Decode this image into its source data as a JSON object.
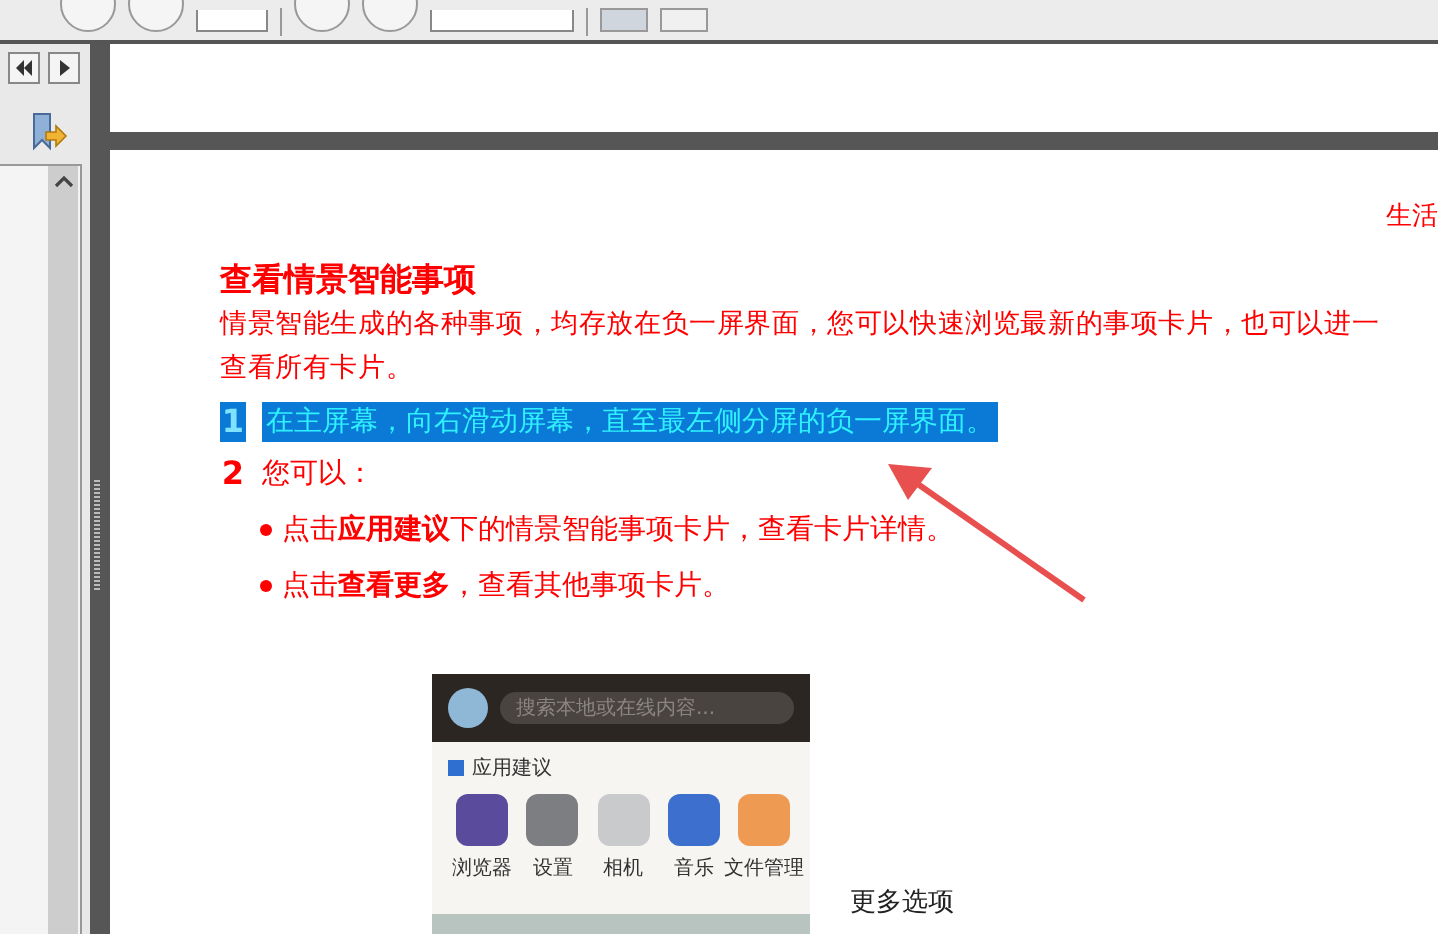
{
  "document": {
    "header_text": "生活",
    "heading": "查看情景智能事项",
    "intro": [
      "情景智能生成的各种事项，均存放在负一屏界面，您可以快速浏览最新的事项卡片，也可以进一",
      "查看所有卡片。"
    ],
    "steps": [
      {
        "number": "1",
        "text": "在主屏幕，向右滑动屏幕，直至最左侧分屏的负一屏界面。",
        "selected": true
      },
      {
        "number": "2",
        "text": "您可以：",
        "selected": false,
        "bullets": [
          "点击**应用建议**下的情景智能事项卡片，查看卡片详情。",
          "点击**查看更多**，查看其他事项卡片。"
        ]
      }
    ],
    "figure": {
      "search_placeholder": "搜索本地或在线内容...",
      "section_title": "应用建议",
      "apps": [
        {
          "label": "浏览器",
          "color": "#5a4b9c"
        },
        {
          "label": "设置",
          "color": "#7c7e82"
        },
        {
          "label": "相机",
          "color": "#c9cacc"
        },
        {
          "label": "音乐",
          "color": "#3d6fcf"
        },
        {
          "label": "文件管理",
          "color": "#ee9a52"
        }
      ]
    },
    "caption": "更多选项"
  }
}
